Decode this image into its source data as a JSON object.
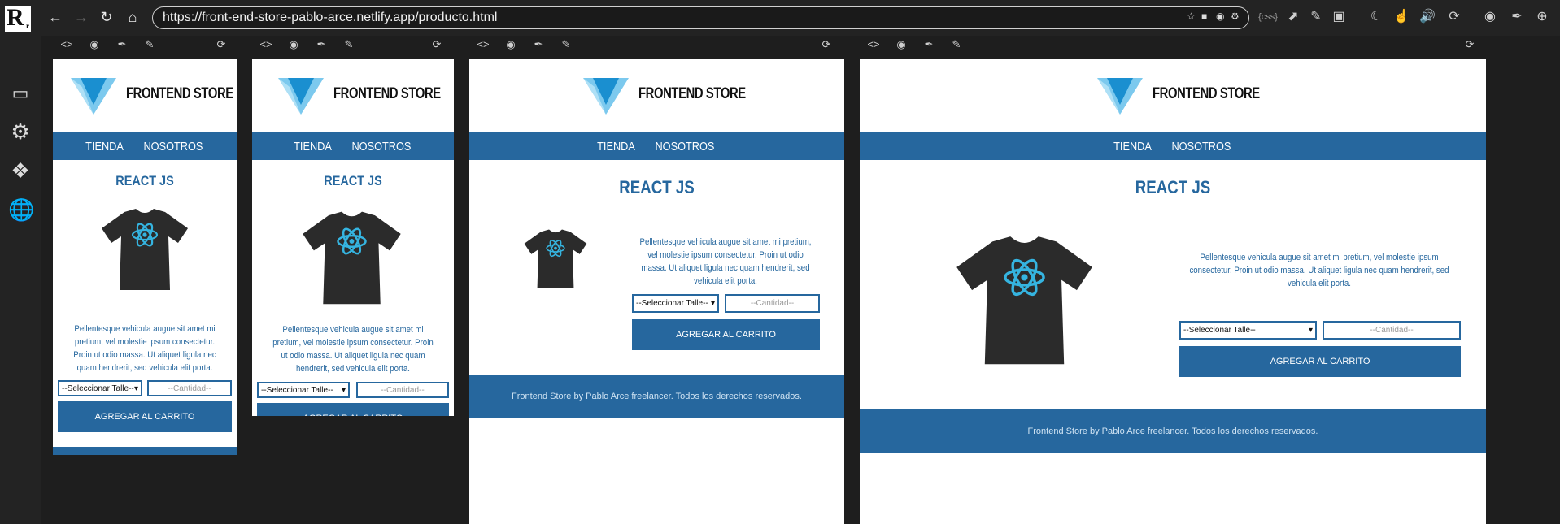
{
  "browser": {
    "url": "https://front-end-store-pablo-arce.netlify.app/producto.html",
    "css_label": "{css}"
  },
  "site": {
    "brand": "FRONTEND STORE",
    "nav": [
      "TIENDA",
      "NOSOTROS"
    ],
    "product_title": "REACT JS",
    "description": "Pellentesque vehicula augue sit amet mi pretium, vel molestie ipsum consectetur. Proin ut odio massa. Ut aliquet ligula nec quam hendrerit, sed vehicula elit porta.",
    "size_select": "--Seleccionar Talle--",
    "quantity_placeholder": "--Cantidad--",
    "add_button": "AGREGAR AL CARRITO",
    "footer": "Frontend Store by Pablo Arce freelancer. Todos los derechos reservados."
  },
  "colors": {
    "primary": "#26679e",
    "logo_light": "#7cc9ee",
    "logo_dark": "#1a8fd0",
    "react_cyan": "#35b4e0"
  }
}
